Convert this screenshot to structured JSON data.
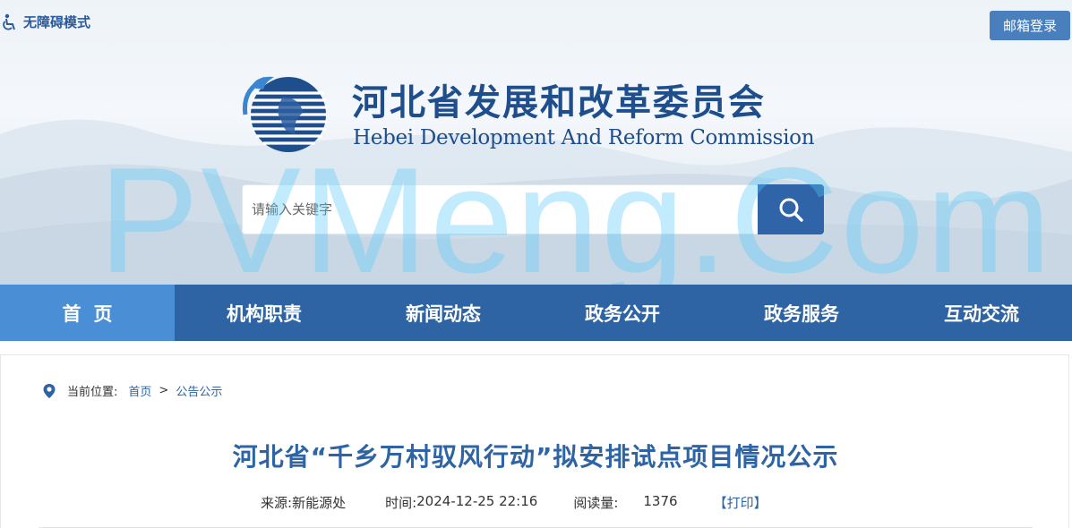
{
  "header": {
    "accessibility_label": "无障碍模式",
    "mail_login_label": "邮箱登录",
    "title_cn": "河北省发展和改革委员会",
    "title_en": "Hebei Development And Reform Commission",
    "watermark": "PVMeng.Com",
    "brand_color": "#1f4e8c"
  },
  "search": {
    "placeholder": "请输入关键字",
    "value": "",
    "icon": "search-icon"
  },
  "nav": {
    "items": [
      {
        "label": "首页",
        "active": true
      },
      {
        "label": "机构职责",
        "active": false
      },
      {
        "label": "新闻动态",
        "active": false
      },
      {
        "label": "政务公开",
        "active": false
      },
      {
        "label": "政务服务",
        "active": false
      },
      {
        "label": "互动交流",
        "active": false
      }
    ],
    "bg_color": "#2e64a3",
    "active_color": "#4a8fd6"
  },
  "breadcrumb": {
    "label": "当前位置:",
    "home": "首页",
    "separator": ">",
    "current": "公告公示"
  },
  "article": {
    "title": "河北省“千乡万村驭风行动”拟安排试点项目情况公示",
    "source_label": "来源:",
    "source_value": "新能源处",
    "time_label": "时间:",
    "time_value": "2024-12-25 22:16",
    "reads_label": "阅读量:",
    "reads_value": "1376",
    "print_label": "【打印】"
  }
}
